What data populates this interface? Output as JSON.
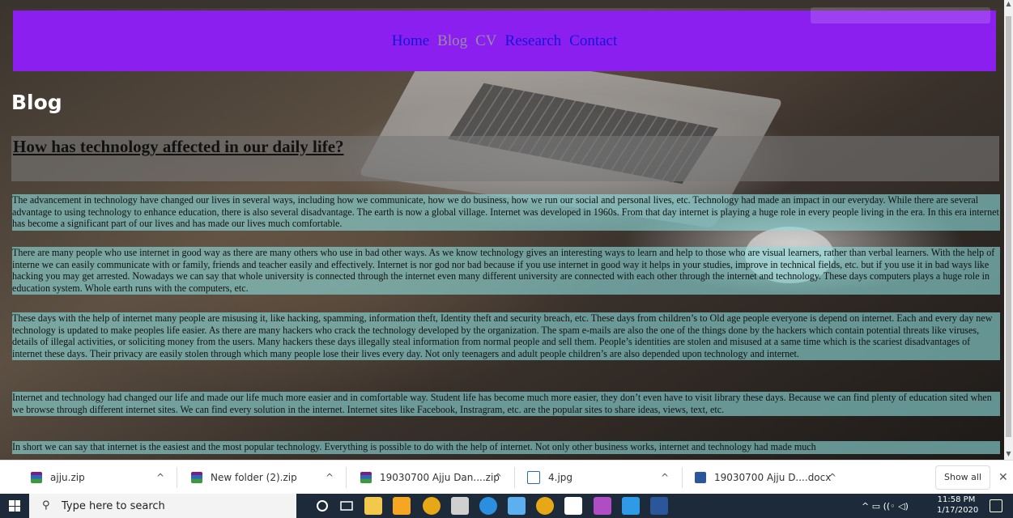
{
  "nav": {
    "links": [
      {
        "label": "Home",
        "color": "#1515d8"
      },
      {
        "label": "Blog",
        "color": "#9a8aa8"
      },
      {
        "label": "CV",
        "color": "#9a8aa8"
      },
      {
        "label": "Research",
        "color": "#1515d8"
      },
      {
        "label": "Contact",
        "color": "#1515d8"
      }
    ],
    "background": "#8b1ff0"
  },
  "page": {
    "heading": "Blog",
    "article_title": "How has technology affected in our daily life?",
    "paragraphs": [
      "The advancement in technology have changed our lives in several ways, including how we communicate, how we do business, how we run our social and personal lives, etc. Technology had made an impact in our everyday. While there are several advantage to using technology to enhance education, there is also several disadvantage. The earth is now a global village. Internet was developed in 1960s. From that day internet is playing a huge role in every people living in the era. In this era internet has become a significant part of our lives and has made our lives much comfortable.",
      "There are many people who use internet in good way as there are many others who use in bad other ways. As we know technology gives an interesting ways to learn and help to those who are visual learners, rather than verbal learners. With the help of interne we can easily communicate with or family, friends and teacher easily and effectively. Internet is nor god nor bad because if you use internet in good way it helps in your studies, improve in technical fields, etc. but if you use it in bad ways like hacking you may get arrested. Nowadays we can say that whole university is connected through the internet even many different university are connected with each other through the internet and technology. These days computers plays a huge role in education system. Whole earth runs with the computers, etc.",
      "These days with the help of internet many people are misusing it, like hacking, spamming, information theft, Identity theft and security breach, etc. These days from children’s to Old age people everyone is depend on internet. Each and every day new technology is updated to make peoples life easier. As there are many hackers who crack the technology developed by the organization. The spam e-mails are also the one of the things done by the hackers which contain potential threats like viruses, details of illegal activities, or soliciting money from the users. Many hackers these days illegally steal information from normal people and sell them. People’s identities are stolen and misused at a same time which is the scariest disadvantages of internet these days. Their privacy are easily stolen through which many people lose their lives every day. Not only teenagers and adult people children’s are also depended upon technology and internet.",
      "Internet and technology had changed our life and made our life much more easier and in comfortable way. Student life has become much more easier, they don’t even have to visit library these days. Because we can find plenty of education sited when we browse through different internet sites. We can find every solution in the internet. Internet sites like Facebook, Instragram, etc. are the popular sites to share ideas, views, text, etc.",
      "In short we can say that internet is the easiest and the most popular technology. Everything is possible to do with the help of internet. Not only other business works, internet and technology had made much"
    ]
  },
  "downloads": {
    "items": [
      {
        "name": "ajju.zip",
        "type": "zip"
      },
      {
        "name": "New folder (2).zip",
        "type": "zip"
      },
      {
        "name": "19030700 Ajju Dan....zip",
        "type": "zip"
      },
      {
        "name": "4.jpg",
        "type": "jpg"
      },
      {
        "name": "19030700 Ajju D....docx",
        "type": "docx"
      }
    ],
    "show_all_label": "Show all",
    "close_glyph": "✕",
    "chevron_glyph": "^"
  },
  "taskbar": {
    "search_placeholder": "Type here to search",
    "time": "11:58 PM",
    "date": "1/17/2020",
    "tray_glyphs": "^ ▭ ((◦ ◁)",
    "apps": [
      {
        "name": "cortana-icon",
        "color": "#ffffff"
      },
      {
        "name": "task-view-icon",
        "color": "#ffffff"
      },
      {
        "name": "file-explorer-icon",
        "color": "#f2c94c"
      },
      {
        "name": "store-icon",
        "color": "#f5a623"
      },
      {
        "name": "chrome-icon",
        "color": "#e6a817"
      },
      {
        "name": "paint-icon",
        "color": "#d0d0d0"
      },
      {
        "name": "edge-icon",
        "color": "#2b8fe0"
      },
      {
        "name": "notepad-icon",
        "color": "#5db0f0"
      },
      {
        "name": "chrome-active-icon",
        "color": "#e6a817"
      },
      {
        "name": "photos-icon",
        "color": "#ffffff"
      },
      {
        "name": "winrar-icon",
        "color": "#b04cc4"
      },
      {
        "name": "vscode-icon",
        "color": "#2f9be6"
      },
      {
        "name": "word-icon",
        "color": "#2b579a"
      }
    ]
  }
}
